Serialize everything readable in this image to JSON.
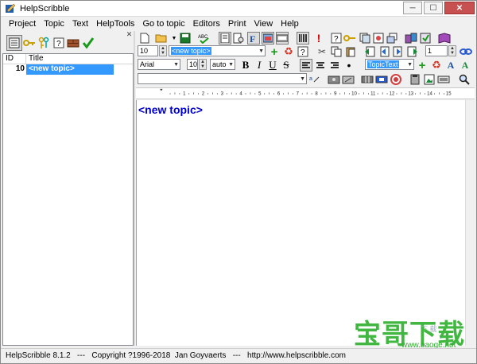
{
  "window": {
    "title": "HelpScribble",
    "minimize": "─",
    "maximize": "☐",
    "close": "✕"
  },
  "menu": [
    "Project",
    "Topic",
    "Text",
    "HelpTools",
    "Go to topic",
    "Editors",
    "Print",
    "View",
    "Help"
  ],
  "topic_list": {
    "columns": {
      "id": "ID",
      "title": "Title"
    },
    "rows": [
      {
        "id": "10",
        "title": "<new topic>"
      }
    ]
  },
  "toolbar": {
    "topic_id_value": "10",
    "topic_title_value": "<new topic>",
    "page_value": "1",
    "font_name": "Arial",
    "font_size": "10",
    "line_spacing": "auto",
    "style_value": "TopicText",
    "bold_label": "B",
    "italic_label": "I",
    "underline_label": "U",
    "strike_label": "S",
    "font_color_a": "A",
    "font_color_b": "A"
  },
  "ruler": {
    "marks": [
      "1",
      "2",
      "3",
      "4",
      "5",
      "6",
      "7",
      "8",
      "9",
      "10",
      "11",
      "12",
      "13",
      "14",
      "15"
    ]
  },
  "editor": {
    "content": "<new topic>"
  },
  "statusbar": {
    "text": "HelpScribble 8.1.2   ---   Copyright ?1996-2018  Jan Goyvaerts   ---   http://www.helpscribble.com"
  },
  "watermark": {
    "brand": "宝哥下载",
    "url": "www.baoge.net",
    "sub": "下  载"
  },
  "colors": {
    "selection": "#3399ff",
    "topic_text": "#0000cc",
    "watermark": "#2db02d"
  }
}
